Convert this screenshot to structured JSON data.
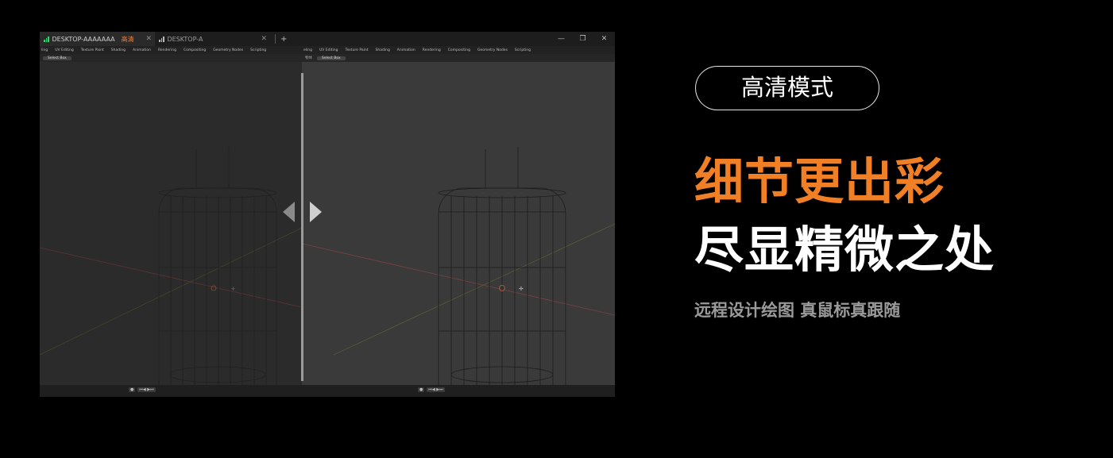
{
  "window": {
    "tabs": [
      {
        "label": "DESKTOP-AAAAAAA",
        "badge": "高清",
        "close": "✕"
      },
      {
        "label": "DESKTOP-A",
        "close": "✕"
      }
    ],
    "add_tab": "+",
    "controls": {
      "minimize": "—",
      "restore": "❐",
      "close": "✕"
    }
  },
  "blender_left": {
    "menu": [
      "ling",
      "UV Editing",
      "Texture Paint",
      "Shading",
      "Animation",
      "Rendering",
      "Compositing",
      "Geometry Nodes",
      "Scripting"
    ],
    "toolbar": {
      "select_box": "Select Box"
    }
  },
  "blender_right": {
    "menu": [
      "eling",
      "UV Editing",
      "Texture Paint",
      "Shading",
      "Animation",
      "Rendering",
      "Compositing",
      "Geometry Nodes",
      "Scripting"
    ],
    "toolbar": {
      "mode": "物体",
      "select_box": "Select Box"
    }
  },
  "promo": {
    "mode_label": "高清模式",
    "headline_1": "细节更出彩",
    "headline_2": "尽显精微之处",
    "subtitle": "远程设计绘图 真鼠标真跟随"
  },
  "colors": {
    "accent": "#f07f25",
    "signal": "#3bd16f",
    "badge": "#ff7a2c"
  }
}
